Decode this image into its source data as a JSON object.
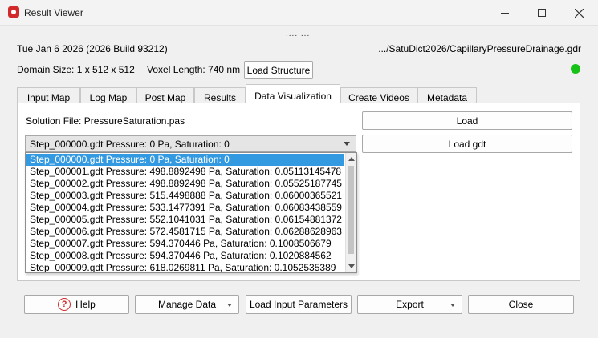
{
  "window": {
    "title": "Result Viewer",
    "icons": {
      "app": "app-logo-icon",
      "minimize": "minimize-icon",
      "maximize": "maximize-icon",
      "close": "close-icon"
    }
  },
  "grip": "........",
  "info": {
    "date": "Tue Jan 6 2026 (2026 Build 93212)",
    "path": ".../SatuDict2026/CapillaryPressureDrainage.gdr",
    "domain_size": "Domain Size: 1 x 512 x 512",
    "voxel_length": "Voxel Length: 740 nm",
    "load_structure": "Load Structure",
    "status_color": "#16c216"
  },
  "tabs": [
    {
      "label": "Input Map"
    },
    {
      "label": "Log Map"
    },
    {
      "label": "Post Map"
    },
    {
      "label": "Results"
    },
    {
      "label": "Data Visualization",
      "active": true
    },
    {
      "label": "Create Videos"
    },
    {
      "label": "Metadata"
    }
  ],
  "panel": {
    "solution_file": "Solution File: PressureSaturation.pas",
    "load": "Load",
    "load_gdt": "Load gdt",
    "combo_value": "Step_000000.gdt Pressure: 0 Pa, Saturation: 0",
    "dropdown_items": [
      "Step_000000.gdt Pressure: 0 Pa, Saturation: 0",
      "Step_000001.gdt Pressure: 498.8892498 Pa, Saturation: 0.05113145478",
      "Step_000002.gdt Pressure: 498.8892498 Pa, Saturation: 0.05525187745",
      "Step_000003.gdt Pressure: 515.4498888 Pa, Saturation: 0.06000365521",
      "Step_000004.gdt Pressure: 533.1477391 Pa, Saturation: 0.06083438559",
      "Step_000005.gdt Pressure: 552.1041031 Pa, Saturation: 0.06154881372",
      "Step_000006.gdt Pressure: 572.4581715 Pa, Saturation: 0.06288628963",
      "Step_000007.gdt Pressure: 594.370446 Pa, Saturation: 0.1008506679",
      "Step_000008.gdt Pressure: 594.370446 Pa, Saturation: 0.1020884562",
      "Step_000009.gdt Pressure: 618.0269811 Pa, Saturation: 0.1052535389"
    ],
    "selected_index": 0
  },
  "bottom": {
    "help": "Help",
    "manage_data": "Manage Data",
    "load_input_parameters": "Load Input Parameters",
    "export": "Export",
    "close": "Close",
    "help_icon_glyph": "?"
  }
}
